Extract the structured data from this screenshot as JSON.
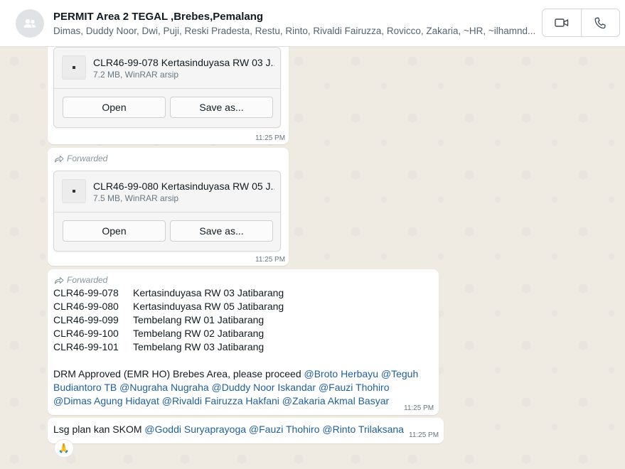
{
  "header": {
    "title": "PERMIT Area 2 TEGAL ,Brebes,Pemalang",
    "subtitle": "Dimas, Duddy Noor, Dwi, Puji, Reski Pradesta, Restu, Rinto, Rivaldi Fairuzza, Rovicco, Zakaria, ~HR, ~ilhamnd..."
  },
  "messages": {
    "file1": {
      "name": "CLR46-99-078 Kertasinduyasa RW 03 J...",
      "meta": "7.2 MB, WinRAR arsip",
      "open_label": "Open",
      "save_label": "Save as...",
      "time": "11:25 PM"
    },
    "file2": {
      "forwarded_label": "Forwarded",
      "name": "CLR46-99-080 Kertasinduyasa RW 05 J...",
      "meta": "7.5 MB, WinRAR arsip",
      "open_label": "Open",
      "save_label": "Save as...",
      "time": "11:25 PM"
    },
    "text1": {
      "forwarded_label": "Forwarded",
      "rows": [
        {
          "code": "CLR46-99-078",
          "desc": "Kertasinduyasa RW 03 Jatibarang"
        },
        {
          "code": "CLR46-99-080",
          "desc": "Kertasinduyasa RW 05 Jatibarang"
        },
        {
          "code": "CLR46-99-099",
          "desc": "Tembelang RW 01 Jatibarang"
        },
        {
          "code": "CLR46-99-100",
          "desc": "Tembelang RW 02 Jatibarang"
        },
        {
          "code": "CLR46-99-101",
          "desc": "Tembelang RW 03 Jatibarang"
        }
      ],
      "approval": "DRM Approved (EMR HO) Brebes Area, please proceed",
      "mentions": [
        "@Broto Herbayu",
        "@Teguh Budiantoro TB",
        "@Nugraha Nugraha",
        "@Duddy Noor Iskandar",
        "@Fauzi Thohiro",
        "@Dimas Agung Hidayat",
        "@Rivaldi Fairuzza Hakfani",
        "@Zakaria Akmal Basyar"
      ],
      "time": "11:25 PM"
    },
    "text2": {
      "prefix": "Lsg plan kan SKOM",
      "mentions": [
        "@Goddi Suryaprayoga",
        "@Fauzi Thohiro",
        "@Rinto Trilaksana"
      ],
      "time": "11:25 PM",
      "reaction": "🙏"
    }
  },
  "icons": {
    "avatar": "group-avatar-icon",
    "video": "video-call-icon",
    "phone": "phone-call-icon",
    "file": "archive-file-icon",
    "forward": "forward-arrow-icon"
  },
  "colors": {
    "chat_background": "#efeae2",
    "bubble": "#ffffff",
    "mention": "#1f5f9a",
    "meta_text": "#667781"
  }
}
